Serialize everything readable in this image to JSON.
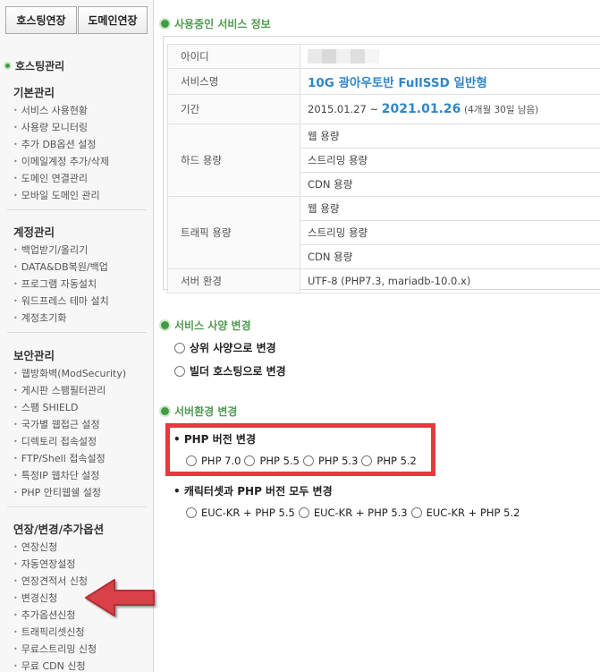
{
  "sidebar": {
    "top_buttons": [
      "호스팅연장",
      "도메인연장"
    ],
    "title": "호스팅관리",
    "sections": [
      {
        "title": "기본관리",
        "items": [
          "서비스 사용현황",
          "사용량 모니터링",
          "추가 DB옵션 설정",
          "이메일계정 추가/삭제",
          "도메인 연결관리",
          "모바일 도메인 관리"
        ]
      },
      {
        "title": "계정관리",
        "items": [
          "백업받기/올리기",
          "DATA&DB복원/백업",
          "프로그램 자동설치",
          "워드프레스 테마 설치",
          "계정초기화"
        ]
      },
      {
        "title": "보안관리",
        "items": [
          "웹방화벽(ModSecurity)",
          "게시판 스팸필터관리",
          "스팸 SHIELD",
          "국가별 웹접근 설정",
          "디렉토리 접속설정",
          "FTP/Shell 접속설정",
          "특정IP 웹차단 설정",
          "PHP 안티웹쉘 설정"
        ]
      },
      {
        "title": "연장/변경/추가옵션",
        "items": [
          "연장신청",
          "자동연장설정",
          "연장견적서 신청",
          "변경신청",
          "추가옵션신청",
          "트래픽리셋신청",
          "무료스트리밍 신청",
          "무료 CDN 신청"
        ]
      }
    ]
  },
  "main": {
    "service_info": {
      "title": "사용중인 서비스 정보",
      "labels": {
        "id": "아이디",
        "service": "서비스명",
        "period": "기간",
        "disk": "하드 용량",
        "traffic": "트래픽 용량",
        "env": "서버 환경"
      },
      "service_name": "10G 광아우토반 FullSSD 일반형",
      "period_start": "2015.01.27 ~",
      "period_end": "2021.01.26",
      "period_remain": "(4개월 30일 남음)",
      "disk_rows": [
        "웹 용량",
        "스트리밍 용량",
        "CDN 용량"
      ],
      "traffic_rows": [
        "웹 용량",
        "스트리밍 용량",
        "CDN 용량"
      ],
      "env": "UTF-8 (PHP7.3, mariadb-10.0.x)"
    },
    "spec_change": {
      "title": "서비스 사양 변경",
      "options": [
        "상위 사양으로 변경",
        "빌더 호스팅으로 변경"
      ]
    },
    "env_change": {
      "title": "서버환경 변경",
      "php_title": "• PHP 버전 변경",
      "php_options": [
        "PHP 7.0",
        "PHP 5.5",
        "PHP 5.3",
        "PHP 5.2"
      ],
      "charset_title": "• 캐릭터셋과 PHP 버전 모두 변경",
      "charset_options": [
        "EUC-KR + PHP 5.5",
        "EUC-KR + PHP 5.3",
        "EUC-KR + PHP 5.2"
      ]
    }
  },
  "colors": {
    "accent_blue": "#2f86c9",
    "header_green": "#4f9a4e",
    "highlight_red": "#e8383d",
    "arrow_red": "#d84147"
  }
}
